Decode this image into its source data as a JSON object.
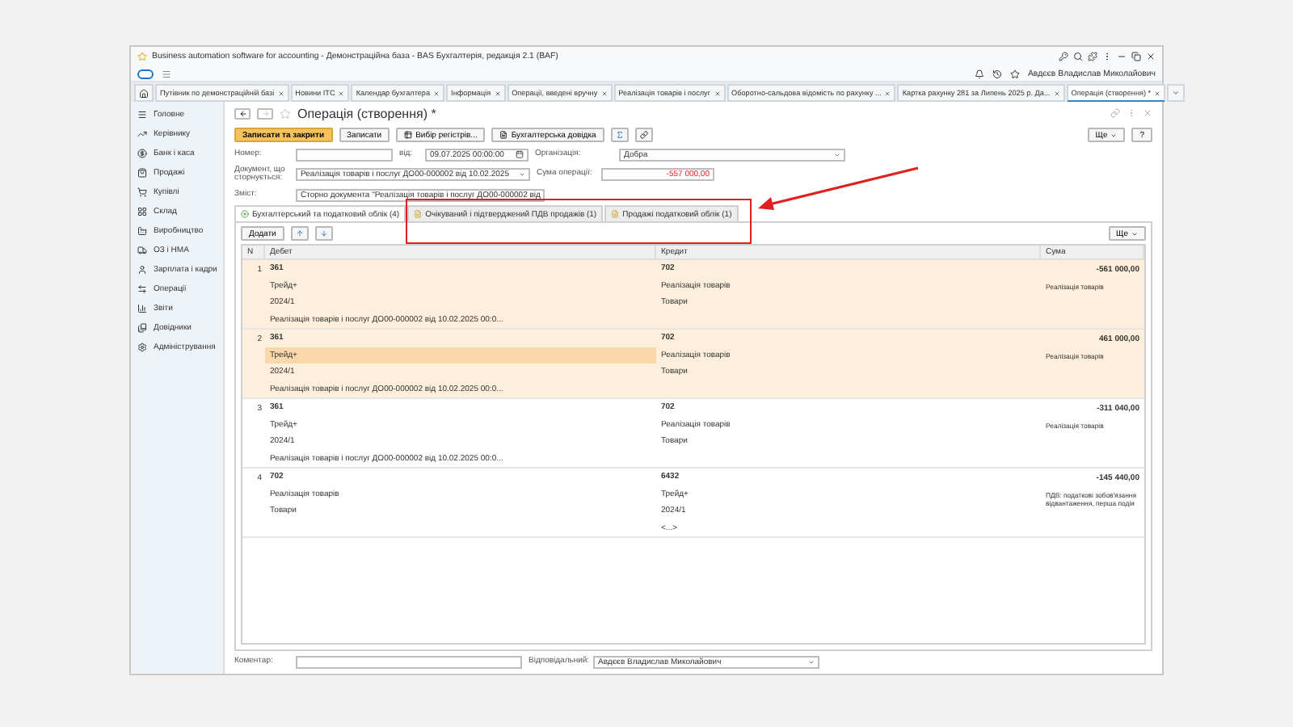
{
  "window": {
    "title": "Business automation software for accounting - Демонстраційна база - BAS Бухгалтерія, редакція 2.1 (BAF)",
    "user": "Авдєєв Владислав Миколайович"
  },
  "tabs": [
    {
      "label": "Путівник по демонстраційній базі",
      "selected": false
    },
    {
      "label": "Новини ITC",
      "selected": false
    },
    {
      "label": "Календар бухгалтера",
      "selected": false
    },
    {
      "label": "Інформація",
      "selected": false
    },
    {
      "label": "Операції, введені вручну",
      "selected": false
    },
    {
      "label": "Реалізація товарів і послуг",
      "selected": false
    },
    {
      "label": "Оборотно-сальдова відомість по рахунку ...",
      "selected": false
    },
    {
      "label": "Картка рахунку 281 за Липень 2025 р. Да...",
      "selected": false
    },
    {
      "label": "Операція (створення) *",
      "selected": true
    }
  ],
  "sidebar": {
    "items": [
      {
        "label": "Головне"
      },
      {
        "label": "Керівнику"
      },
      {
        "label": "Банк і каса"
      },
      {
        "label": "Продажі"
      },
      {
        "label": "Купівлі"
      },
      {
        "label": "Склад"
      },
      {
        "label": "Виробництво"
      },
      {
        "label": "ОЗ і НМА"
      },
      {
        "label": "Зарплата і кадри"
      },
      {
        "label": "Операції"
      },
      {
        "label": "Звіти"
      },
      {
        "label": "Довідники"
      },
      {
        "label": "Адміністрування"
      }
    ]
  },
  "form": {
    "title": "Операція (створення) *",
    "buttons": [
      {
        "label": "Записати та закрити",
        "kind": "primary"
      },
      {
        "label": "Записати",
        "kind": "plain"
      },
      {
        "label": "Вибір регістрів...",
        "kind": "registers"
      },
      {
        "label": "Бухгалтерська довідка",
        "kind": "report"
      }
    ],
    "more": "Ще",
    "help": "?",
    "number": {
      "label": "Номер:"
    },
    "date": {
      "label": "від:",
      "value": "09.07.2025 00:00:00"
    },
    "organization": {
      "label": "Організація:",
      "value": "Добра"
    },
    "document": {
      "label": "Документ, що сторнується:",
      "value": "Реалізація товарів і послуг ДО00-000002 від 10.02.2025"
    },
    "amount": {
      "label": "Сума операції:",
      "value": "-557 000,00"
    },
    "content": {
      "label": "Зміст:",
      "value": "Сторно документа \"Реалізація товарів і послуг ДО00-000002 від"
    },
    "subtabs": [
      {
        "label": "Бухгалтерський та податковий облік (4)",
        "selected": true
      },
      {
        "label": "Очікуваний і підтверджений ПДВ продажів (1)",
        "selected": false
      },
      {
        "label": "Продажі податковий облік (1)",
        "selected": false
      }
    ],
    "table": {
      "add": "Додати",
      "more": "Ще",
      "columns": [
        "N",
        "Дебет",
        "Кредит",
        "Сума"
      ],
      "rows": [
        {
          "n": "1",
          "selected": true,
          "debit": [
            {
              "text": "361",
              "selected": false
            },
            {
              "text": "Трейд+",
              "selected": false
            },
            {
              "text": "2024/1",
              "selected": false
            },
            {
              "text": "Реалізація товарів і послуг ДО00-000002 від 10.02.2025 00:0...",
              "selected": false
            }
          ],
          "credit": [
            "702",
            "Реалізація товарів",
            "Товари"
          ],
          "sum": "-561 000,00",
          "note": "Реалізація товарів"
        },
        {
          "n": "2",
          "selected": true,
          "debit": [
            {
              "text": "361",
              "selected": false
            },
            {
              "text": "Трейд+",
              "selected": true
            },
            {
              "text": "2024/1",
              "selected": false
            },
            {
              "text": "Реалізація товарів і послуг ДО00-000002 від 10.02.2025 00:0...",
              "selected": false
            }
          ],
          "credit": [
            "702",
            "Реалізація товарів",
            "Товари"
          ],
          "sum": "461 000,00",
          "note": "Реалізація товарів"
        },
        {
          "n": "3",
          "selected": false,
          "debit": [
            {
              "text": "361",
              "selected": false
            },
            {
              "text": "Трейд+",
              "selected": false
            },
            {
              "text": "2024/1",
              "selected": false
            },
            {
              "text": "Реалізація товарів і послуг ДО00-000002 від 10.02.2025 00:0...",
              "selected": false
            }
          ],
          "credit": [
            "702",
            "Реалізація товарів",
            "Товари"
          ],
          "sum": "-311 040,00",
          "note": "Реалізація товарів"
        },
        {
          "n": "4",
          "selected": false,
          "debit": [
            {
              "text": "702",
              "selected": false
            },
            {
              "text": "Реалізація товарів",
              "selected": false
            },
            {
              "text": "Товари",
              "selected": false
            }
          ],
          "credit": [
            "6432",
            "Трейд+",
            "2024/1",
            "<...>"
          ],
          "sum": "-145 440,00",
          "note": "ПДВ: податкові зобов'язання відвантаження, перша подія"
        }
      ]
    },
    "comment": {
      "label": "Коментар:"
    },
    "responsible": {
      "label": "Відповідальний:",
      "value": "Авдєєв Владислав Миколайович"
    }
  }
}
